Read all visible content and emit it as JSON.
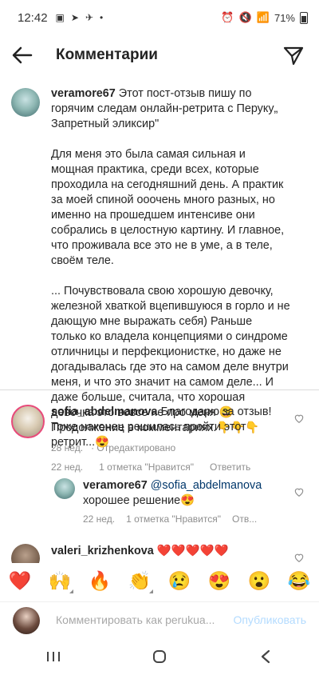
{
  "status_bar": {
    "time": "12:42",
    "battery": "71%"
  },
  "header": {
    "title": "Комментарии"
  },
  "post": {
    "username": "veramore67",
    "caption_first": " Этот пост-отзыв пишу по горячим следам онлайн-ретрита с Перуку„ Запретный эликсир\"",
    "paragraph_2": "Для меня это была самая сильная и мощная практика, среди всех, которые проходила на сегодняшний день. А практик за моей спиной ооочень много разных, но именно на прошедшем интенсиве они собрались в целостную картину. И главное, что проживала все это не в уме, а в  теле, своём теле.",
    "paragraph_3": "... Почувствовала свою хорошую девочку, железной хваткой вцепившуюся в горло и не дающую мне выражать себя) Раньше только ко владела концепциями о синдроме отличницы и перфекционистке, но даже не догадывалась где это на самом деле внутри меня, и что это значит на самом деле... И даже больше, считала, что хорошая девочка это вовсе не про меня 😄Продолжение в комментариях.👇👇👇",
    "time": "28 нед.",
    "edited": "· Отредактировано"
  },
  "comments": [
    {
      "username": "sofia_abdelmanova",
      "text": " Благодарю за отзыв! Тоже наконец решилась пройти этот ретрит...😍",
      "time": "22 нед.",
      "likes": "1 отметка \"Нравится\"",
      "reply_label": "Ответить"
    },
    {
      "username": "veramore67",
      "mention": " @sofia_abdelmanova",
      "text": " хорошее решение😍",
      "time": "22 нед.",
      "likes": "1 отметка \"Нравится\"",
      "reply_label": "Отв..."
    },
    {
      "username": "valeri_krizhenkova",
      "text": " ❤️❤️❤️❤️❤️"
    }
  ],
  "emoji_bar": [
    "❤️",
    "🙌",
    "🔥",
    "👏",
    "😢",
    "😍",
    "😮",
    "😂"
  ],
  "compose": {
    "placeholder": "Комментировать как perukua...",
    "publish_label": "Опубликовать"
  },
  "colors": {
    "accent": "#0095f6",
    "publish_disabled": "#b3dbff",
    "story_ring": "#e84a7a"
  }
}
